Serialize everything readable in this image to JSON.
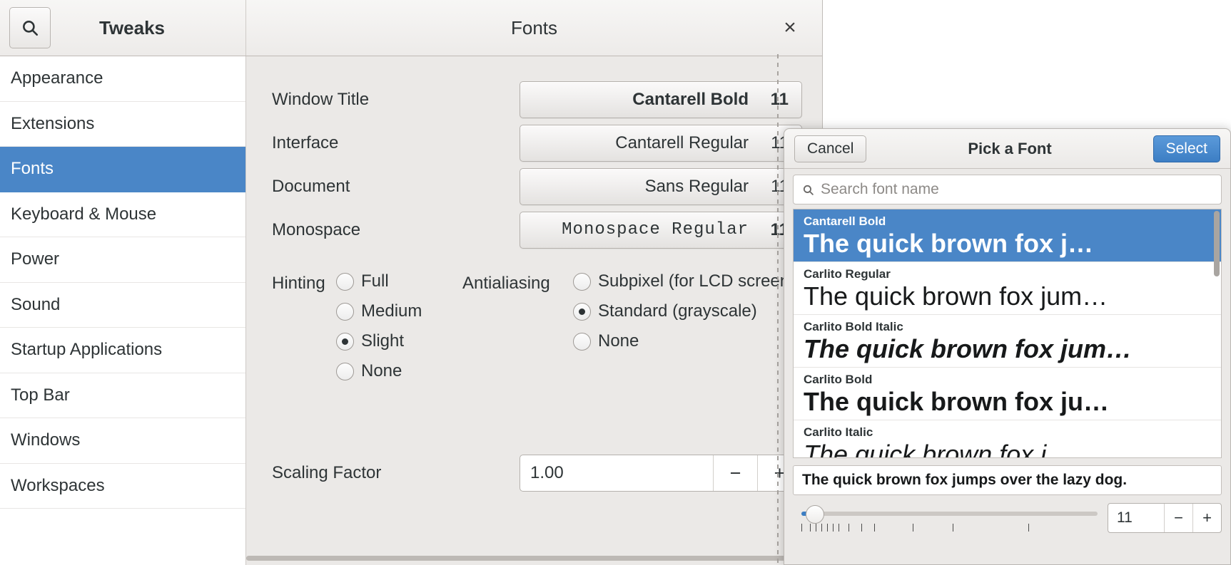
{
  "app": {
    "title": "Tweaks",
    "search_icon": "search-icon",
    "panel_title": "Fonts",
    "close_icon": "close-icon"
  },
  "sidebar": {
    "items": [
      {
        "label": "Appearance",
        "selected": false
      },
      {
        "label": "Extensions",
        "selected": false
      },
      {
        "label": "Fonts",
        "selected": true
      },
      {
        "label": "Keyboard & Mouse",
        "selected": false
      },
      {
        "label": "Power",
        "selected": false
      },
      {
        "label": "Sound",
        "selected": false
      },
      {
        "label": "Startup Applications",
        "selected": false
      },
      {
        "label": "Top Bar",
        "selected": false
      },
      {
        "label": "Windows",
        "selected": false
      },
      {
        "label": "Workspaces",
        "selected": false
      }
    ]
  },
  "fonts_panel": {
    "rows": [
      {
        "label": "Window Title",
        "font": "Cantarell Bold",
        "size": "11",
        "weight": "bold"
      },
      {
        "label": "Interface",
        "font": "Cantarell Regular",
        "size": "11",
        "weight": "regular"
      },
      {
        "label": "Document",
        "font": "Sans Regular",
        "size": "11",
        "weight": "regular"
      },
      {
        "label": "Monospace",
        "font": "Monospace Regular",
        "size": "11",
        "weight": "mono"
      }
    ],
    "hinting": {
      "legend": "Hinting",
      "options": [
        {
          "label": "Full",
          "selected": false
        },
        {
          "label": "Medium",
          "selected": false
        },
        {
          "label": "Slight",
          "selected": true
        },
        {
          "label": "None",
          "selected": false
        }
      ]
    },
    "antialiasing": {
      "legend": "Antialiasing",
      "options": [
        {
          "label": "Subpixel (for LCD screens)",
          "selected": false
        },
        {
          "label": "Standard (grayscale)",
          "selected": true
        },
        {
          "label": "None",
          "selected": false
        }
      ]
    },
    "scaling": {
      "label": "Scaling Factor",
      "value": "1.00",
      "minus": "−",
      "plus": "+"
    }
  },
  "font_dialog": {
    "cancel_label": "Cancel",
    "title": "Pick a Font",
    "select_label": "Select",
    "search_placeholder": "Search font name",
    "search_icon": "search-icon",
    "list": [
      {
        "name": "Cantarell Bold",
        "sample": "The quick brown fox j…",
        "style": "b",
        "selected": true
      },
      {
        "name": "Carlito Regular",
        "sample": "The quick brown fox jum…",
        "style": "",
        "selected": false
      },
      {
        "name": "Carlito Bold Italic",
        "sample": "The quick brown fox jum…",
        "style": "bi",
        "selected": false
      },
      {
        "name": "Carlito Bold",
        "sample": "The quick brown fox ju…",
        "style": "b",
        "selected": false
      },
      {
        "name": "Carlito Italic",
        "sample": "The quick brown fox j…",
        "style": "i",
        "selected": false
      }
    ],
    "preview_text": "The quick brown fox jumps over the lazy dog.",
    "size_value": "11",
    "size_minus": "−",
    "size_plus": "+"
  },
  "colors": {
    "accent": "#4a86c7",
    "primary_button": "#3c7ec4",
    "panel_bg": "#ebe9e7",
    "sidebar_bg": "#ffffff"
  }
}
